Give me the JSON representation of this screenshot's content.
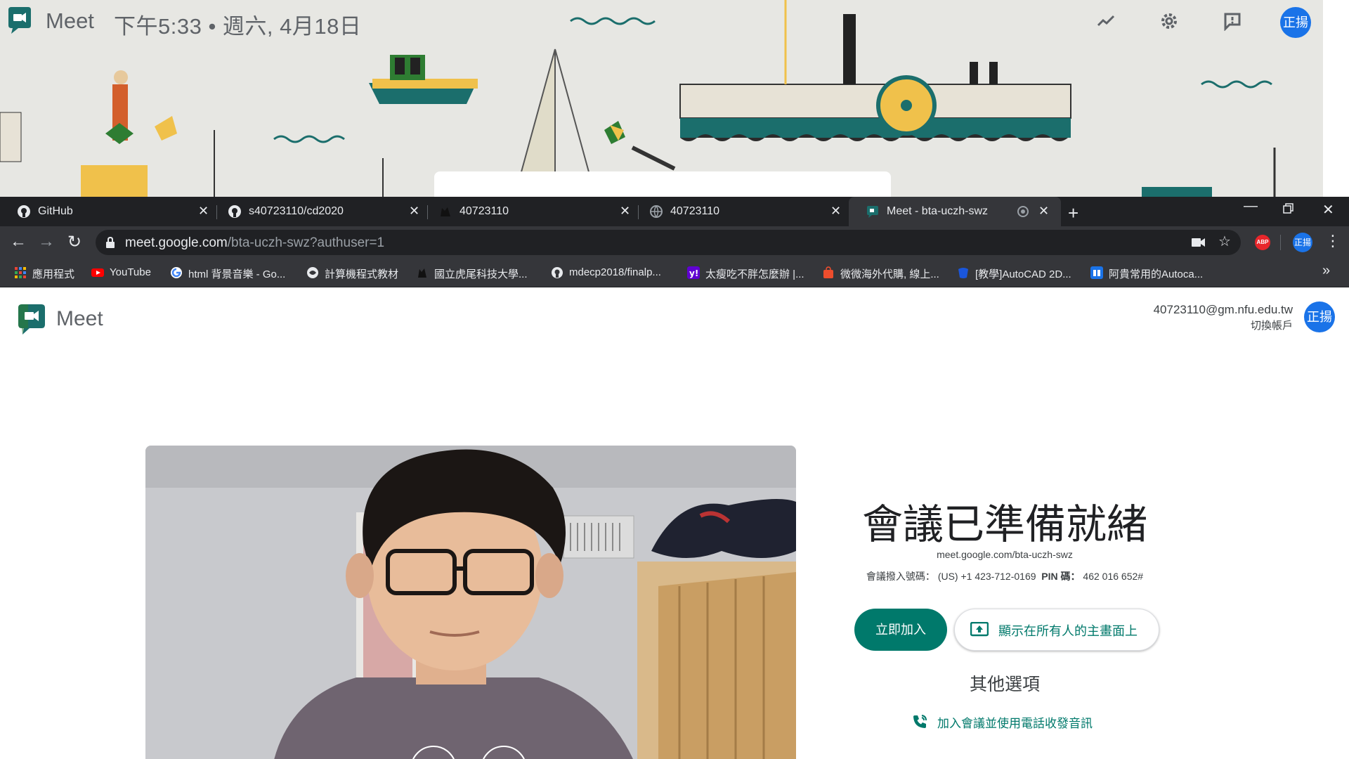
{
  "background_meet": {
    "app_name": "Meet",
    "clock": "下午5:33  •  週六, 4月18日",
    "avatar_text": "正揚"
  },
  "tabs": [
    {
      "label": "GitHub",
      "icon": "github-icon"
    },
    {
      "label": "s40723110/cd2020",
      "icon": "github-icon"
    },
    {
      "label": "40723110",
      "icon": "cat-icon"
    },
    {
      "label": "40723110",
      "icon": "globe-icon"
    },
    {
      "label": "Meet - bta-uczh-swz",
      "icon": "meet-icon",
      "active": true,
      "recording": true
    }
  ],
  "toolbar": {
    "url_host": "meet.google.com",
    "url_path": "/bta-uczh-swz?authuser=1",
    "abp_label": "ABP",
    "avatar_text": "正揚"
  },
  "bookmarks": [
    {
      "label": "應用程式",
      "icon": "apps-icon",
      "color": "#ea4335"
    },
    {
      "label": "YouTube",
      "icon": "youtube-icon",
      "color": "#ff0000"
    },
    {
      "label": "html 背景音樂 - Go...",
      "icon": "google-icon",
      "color": "#4285f4"
    },
    {
      "label": "計算機程式教材",
      "icon": "globe-icon",
      "color": "#e8eaed"
    },
    {
      "label": "國立虎尾科技大學...",
      "icon": "cat-icon",
      "color": "#202124"
    },
    {
      "label": "mdecp2018/finalp...",
      "icon": "github-icon",
      "color": "#e8eaed"
    },
    {
      "label": "太瘦吃不胖怎麼辦 |...",
      "icon": "yahoo-icon",
      "color": "#6001d2"
    },
    {
      "label": "微微海外代購, 線上...",
      "icon": "bag-icon",
      "color": "#ee4d2d"
    },
    {
      "label": "[教學]AutoCAD 2D...",
      "icon": "blogger-icon",
      "color": "#1a56db"
    },
    {
      "label": "阿貴常用的Autoca...",
      "icon": "doc-icon",
      "color": "#1a73e8"
    }
  ],
  "account": {
    "email": "40723110@gm.nfu.edu.tw",
    "switch_label": "切換帳戶",
    "avatar_text": "正揚"
  },
  "meeting": {
    "app_name": "Meet",
    "ready_title": "會議已準備就緒",
    "url": "meet.google.com/bta-uczh-swz",
    "dial_label": "會議撥入號碼：",
    "dial_number": "(US) +1 423-712-0169",
    "pin_label": "PIN 碼：",
    "pin": "462 016 652#",
    "join_label": "立即加入",
    "present_label": "顯示在所有人的主畫面上",
    "other_options": "其他選項",
    "phone_option": "加入會議並使用電話收發音訊"
  },
  "colors": {
    "accent": "#00796b",
    "avatar": "#1a73e8",
    "chrome_dark": "#202124",
    "chrome_toolbar": "#35363a"
  }
}
